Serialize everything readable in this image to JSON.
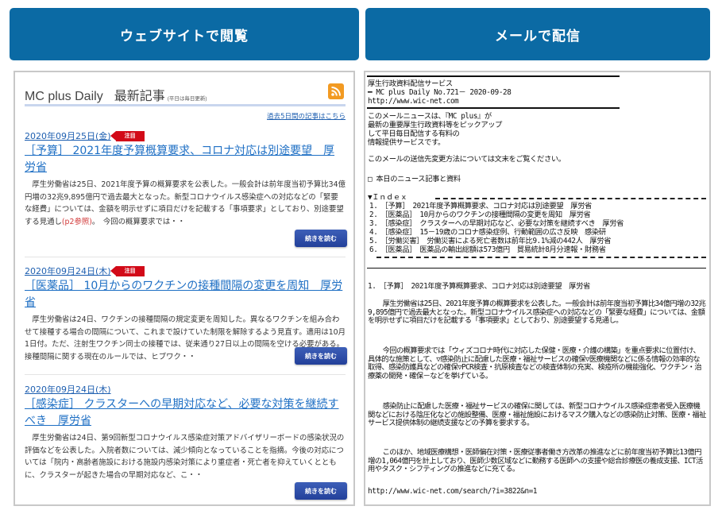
{
  "tabs": {
    "web": "ウェブサイトで閲覧",
    "mail": "メールで配信"
  },
  "web": {
    "title": "MC plus Daily",
    "title_jp": "最新記事",
    "title_note": "(平日は毎日更新)",
    "rss_icon": "rss-icon",
    "past_link": "過去5日間の記事はこちら",
    "more_label": "続きを読む",
    "badge_label": "注目",
    "articles": [
      {
        "date": "2020年09月25日(金)",
        "featured": true,
        "title": "［予算］ 2021年度予算概算要求、コロナ対応は別途要望　厚労省",
        "body": "厚生労働省は25日、2021年度予算の概算要求を公表した。一般会計は前年度当初予算比34億円増の32兆9,895億円で過去最大となった。新型コロナウイルス感染症への対応などの「緊要な経費」については、金額を明示せずに項目だけを記載する「事項要求」としており、別途要望する見通し",
        "ref": "(p2参照)",
        "tail": "。　今回の概算要求では・・"
      },
      {
        "date": "2020年09月24日(木)",
        "featured": true,
        "title": "［医薬品］ 10月からのワクチンの接種間隔の変更を周知　厚労省",
        "body": "厚生労働省は24日、ワクチンの接種間隔の規定変更を周知した。異なるワクチンを組み合わせて接種する場合の間隔について、これまで設けていた制限を解除するよう見直す。適用は10月1日付。ただ、注射生ワクチン同士の接種では、従来通り27日以上の間隔を空ける必要がある。　接種間隔に関する現在のルールでは、ヒブワク・・"
      },
      {
        "date": "2020年09月24日(木)",
        "featured": false,
        "title": "［感染症］ クラスターへの早期対応など、必要な対策を継続すべき　厚労省",
        "body": "厚生労働省は24日、第9回新型コロナウイルス感染症対策アドバイザリーボードの感染状況の評価などを公表した。入院者数については、減少傾向となっていることを指摘。今後の対応については「院内・高齢者施設における施設内感染対策により重症者・死亡者を抑えていくとともに、クラスターが起きた場合の早期対応など、こ・・"
      }
    ]
  },
  "mail": {
    "header": [
      "厚生行政資料配信サービス",
      "━ MC plus Daily No.721－ 2020-09-28",
      "http://www.wic-net.com"
    ],
    "intro": [
      "このメールニュースは、『MC plus』が",
      "最新の重要厚生行政資料等をピックアップ",
      "して平日毎日配信する有料の",
      "情報提供サービスです。"
    ],
    "change_note": "このメールの送信先変更方法については文末をご覧ください。",
    "section": "□ 本日のニュース記事と資料",
    "index_label": "▼Ｉｎｄｅｘ",
    "index": [
      "1.　［予算］　2021年度予算概算要求、コロナ対応は別途要望　厚労省",
      "2.　［医薬品］　10月からのワクチンの接種間隔の変更を周知　厚労省",
      "3.　［感染症］　クラスターへの早期対応など、必要な対策を継続すべき　厚労省",
      "4.　［感染症］　15－19歳のコロナ感染症例、行動範囲の広さ反映　感染研",
      "5.　［労働災害］　労働災害による死亡者数は前年比9.1%減の442人　厚労省",
      "6.　［医薬品］　医薬品の輸出総額は573億円　貿易統計8月分速報・財務省"
    ],
    "article_title": "1.　［予算］　2021年度予算概算要求、コロナ対応は別途要望　厚労省",
    "paragraphs": [
      "厚生労働省は25日、2021年度予算の概算要求を公表した。一般会計は前年度当初予算比34億円増の32兆9,895億円で過去最大となった。新型コロナウイルス感染症への対応などの「緊要な経費」については、金額を明示せずに項目だけを記載する「事項要求」としており、別途要望する見通し。",
      "今回の概算要求では「ウィズコロナ時代に対応した保健・医療・介護の構築」を重点要求に位置付け、具体的な施策として、▽感染防止に配慮した医療・福祉サービスの確保▽医療機関などに係る情報の効率的な取得、感染防護具などの確保▽PCR検査・抗原検査などの検査体制の充実、検疫所の機能強化、ワクチン・治療薬の開発・確保－などを挙げている。",
      "感染防止に配慮した医療・福祉サービスの確保に関しては、新型コロナウイルス感染症患者受入医療機関などにおける陰圧化などの施設整備、医療・福祉施設におけるマスク購入などの感染防止対策、医療・福祉サービス提供体制の継続支援などの予算を要求する。",
      "このほか、地域医療構想・医師偏在対策・医療従事者働き方改革の推進などに前年度当初予算比13億円増の1,064億円を計上しており、医師少数区域などに勤務する医師への支援や総合診療医の養成支援、ICT活用やタスク・シフティングの推進などに充てる。"
    ],
    "link": "http://www.wic-net.com/search/?i=3822&n=1"
  }
}
